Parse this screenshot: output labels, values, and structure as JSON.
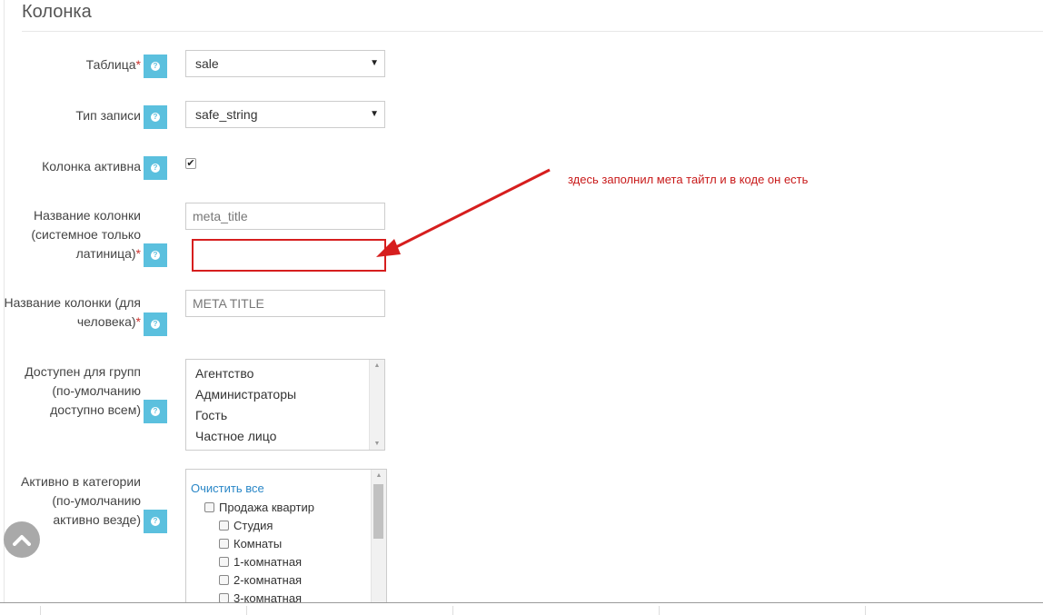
{
  "page": {
    "title": "Колонка"
  },
  "form": {
    "table": {
      "label": "Таблица",
      "required": "*",
      "value": "sale"
    },
    "record_type": {
      "label": "Тип записи",
      "value": "safe_string"
    },
    "active": {
      "label": "Колонка активна",
      "checked": true
    },
    "column_name": {
      "label_lines": [
        "Название колонки",
        "(системное только",
        "латиница)"
      ],
      "required": "*",
      "value": "meta_title"
    },
    "human_name": {
      "label_lines": [
        "Название колонки (для",
        "человека)"
      ],
      "required": "*",
      "value": "META TITLE"
    },
    "groups": {
      "label_lines": [
        "Доступен для групп",
        "(по-умолчанию",
        "доступно всем)"
      ],
      "options": [
        "Агентство",
        "Администраторы",
        "Гость",
        "Частное лицо"
      ]
    },
    "categories": {
      "label_lines": [
        "Активно в категории",
        "(по-умолчанию",
        "активно везде)"
      ],
      "clear_all": "Очистить все",
      "items": [
        "Продажа квартир",
        "Студия",
        "Комнаты",
        "1-комнатная",
        "2-комнатная",
        "3-комнатная"
      ]
    }
  },
  "help_icon": "question-circle-icon",
  "annotation": {
    "text": "здесь заполнил мета тайтл и в коде он есть",
    "color": "#c81919"
  },
  "colors": {
    "help_button": "#5bc0de",
    "required": "#c9302c",
    "link": "#2a87c7"
  },
  "scroll_top_icon": "chevron-up-icon"
}
